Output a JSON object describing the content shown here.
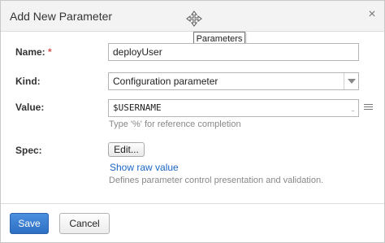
{
  "dialog": {
    "title": "Add New Parameter",
    "close_glyph": "×",
    "tooltip": "Parameters"
  },
  "form": {
    "name": {
      "label": "Name:",
      "required_mark": "*",
      "value": "deployUser"
    },
    "kind": {
      "label": "Kind:",
      "selected": "Configuration parameter"
    },
    "value": {
      "label": "Value:",
      "value": "$USERNAME",
      "hint": "Type '%' for reference completion"
    },
    "spec": {
      "label": "Spec:",
      "edit_label": "Edit...",
      "raw_link": "Show raw value",
      "description": "Defines parameter control presentation and validation."
    }
  },
  "footer": {
    "save_label": "Save",
    "cancel_label": "Cancel"
  },
  "colors": {
    "primary": "#2e6fc2",
    "link": "#1a66c8",
    "required": "#d9534f"
  }
}
